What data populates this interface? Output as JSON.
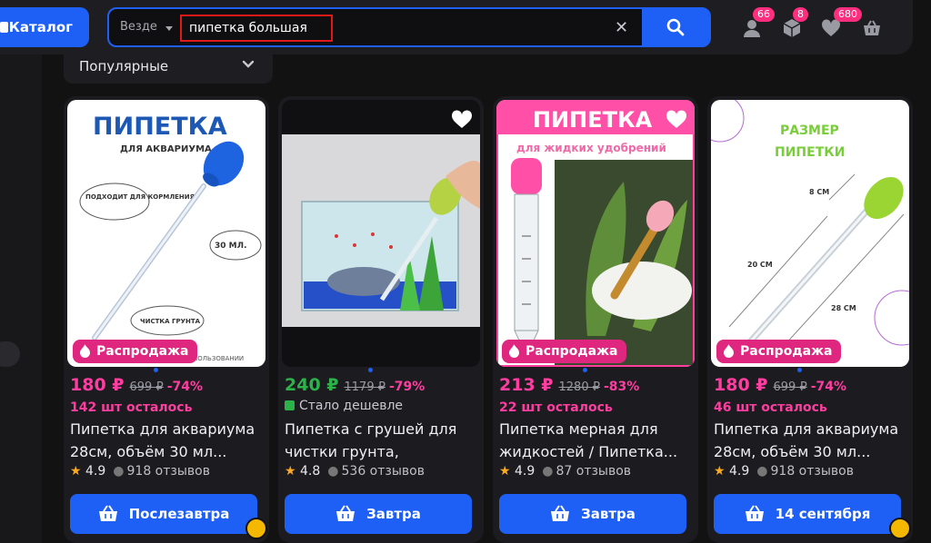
{
  "header": {
    "catalog_label": "Каталог",
    "search_scope": "Везде",
    "search_value": "пипетка большая",
    "badges": {
      "profile": "66",
      "orders": "8",
      "favorites": "680"
    }
  },
  "sort": {
    "label": "Популярные"
  },
  "products": [
    {
      "img_title": "ПИПЕТКА",
      "img_sub": "ДЛЯ АКВАРИУМА",
      "img_note1": "ПОДХОДИТ ДЛЯ КОРМЛЕНИЯ",
      "img_note2": "30 МЛ.",
      "img_note3": "ЧИСТКА ГРУНТА",
      "img_note4": "ПОЛЬЗОВАНИИ",
      "promo": "Распродажа",
      "price": "180 ₽",
      "old_price": "699 ₽",
      "discount": "-74%",
      "stock": "142 шт осталось",
      "title": "Пипетка для аквариума 28см, объём 30 мл...",
      "rating": "4.9",
      "reviews": "918 отзывов",
      "delivery": "Послезавтра"
    },
    {
      "price": "240 ₽",
      "old_price": "1179 ₽",
      "discount": "-79%",
      "cheaper": "Стало дешевле",
      "title": "Пипетка с грушей для чистки грунта, аквариума...",
      "rating": "4.8",
      "reviews": "536 отзывов",
      "delivery": "Завтра"
    },
    {
      "img_title": "ПИПЕТКА",
      "img_sub": "для жидких удобрений",
      "promo": "Распродажа",
      "price": "213 ₽",
      "old_price": "1280 ₽",
      "discount": "-83%",
      "stock": "22 шт осталось",
      "title": "Пипетка мерная для жидкостей / Пипетка...",
      "rating": "4.9",
      "reviews": "87 отзывов",
      "delivery": "Завтра"
    },
    {
      "img_title": "РАЗМЕР",
      "img_sub": "ПИПЕТКИ",
      "dim1": "8 СМ",
      "dim2": "20 СМ",
      "dim3": "28 СМ",
      "promo": "Распродажа",
      "price": "180 ₽",
      "old_price": "699 ₽",
      "discount": "-74%",
      "stock": "46 шт осталось",
      "title": "Пипетка для аквариума 28см, объём 30 мл...",
      "rating": "4.9",
      "reviews": "918 отзывов",
      "delivery": "14 сентября"
    }
  ],
  "colors": {
    "accent": "#1e60f5",
    "sale": "#ff3da0",
    "promo_bg": "#e02780",
    "green_price": "#2bb34a",
    "badge": "#ff2d7e"
  }
}
